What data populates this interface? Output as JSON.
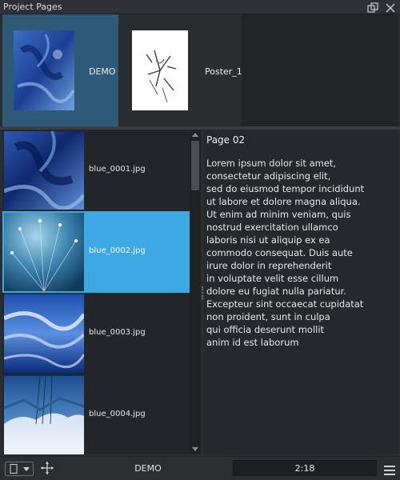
{
  "window": {
    "title": "Project Pages",
    "icons": [
      "float-window-icon",
      "close-icon"
    ]
  },
  "pages": {
    "items": [
      {
        "name": "DEMO",
        "selected": true,
        "thumb_icon": "blue-texture-thumbnail"
      },
      {
        "name": "Poster_1",
        "selected": false,
        "thumb_icon": "sketch-thumbnail"
      }
    ]
  },
  "images": {
    "items": [
      {
        "filename": "blue_0001.jpg",
        "selected": false
      },
      {
        "filename": "blue_0002.jpg",
        "selected": true
      },
      {
        "filename": "blue_0003.jpg",
        "selected": false
      },
      {
        "filename": "blue_0004.jpg",
        "selected": false
      }
    ]
  },
  "text_panel": {
    "title": "Page 02",
    "lines": [
      "Lorem ipsum dolor sit amet,",
      "consectetur adipiscing elit,",
      "sed do eiusmod tempor incididunt",
      "ut labore et dolore magna aliqua.",
      "Ut enim ad minim veniam, quis",
      "nostrud exercitation ullamco",
      "laboris nisi ut aliquip ex ea",
      "commodo consequat. Duis aute",
      "irure dolor in reprehenderit",
      "in voluptate velit esse cillum",
      "dolore eu fugiat nulla pariatur.",
      "Excepteur sint occaecat cupidatat",
      "non proident, sunt in culpa",
      "qui officia deserunt mollit",
      "anim id est laborum"
    ]
  },
  "bottom_bar": {
    "page_name": "DEMO",
    "timecode": "2:18",
    "icons": [
      "page-mode-icon",
      "move-icon",
      "hamburger-menu-icon"
    ]
  },
  "colors": {
    "selection": "#3ea8e5",
    "page_selection": "#2e5a78",
    "background": "#2b2e31"
  }
}
